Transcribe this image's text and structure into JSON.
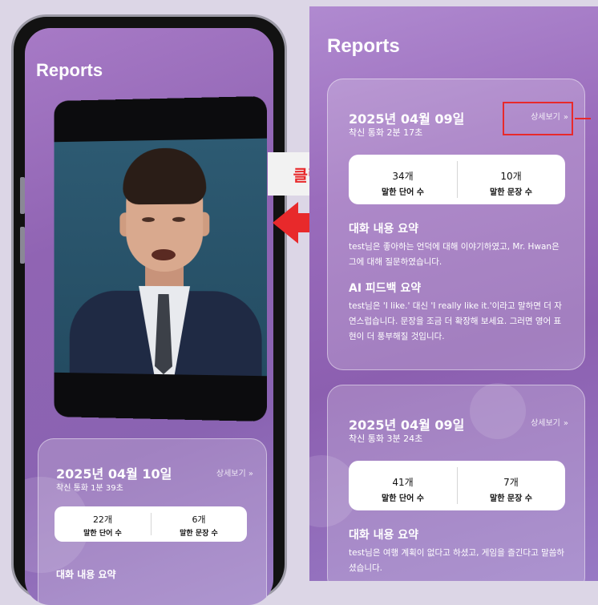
{
  "left_phone": {
    "title": "Reports",
    "mini_card": {
      "date": "2025년 04월 10일",
      "sub": "착신 통화 1분 39초",
      "detail": "상세보기 »",
      "stats": [
        {
          "value": "22개",
          "label": "말한 단어 수"
        },
        {
          "value": "6개",
          "label": "말한 문장 수"
        }
      ],
      "summary_head": "대화 내용 요약"
    }
  },
  "annotation": {
    "click_label": "클릭",
    "accent_color": "#e8292b"
  },
  "right_screen": {
    "title": "Reports",
    "cards": [
      {
        "date": "2025년 04월 09일",
        "sub": "착신 통화 2분 17초",
        "detail": "상세보기",
        "detail_chevron": "»",
        "stats": [
          {
            "value": "34개",
            "label": "말한 단어 수"
          },
          {
            "value": "10개",
            "label": "말한 문장 수"
          }
        ],
        "summary_head": "대화 내용 요약",
        "summary_body": "test님은 좋아하는 언덕에 대해 이야기하였고, Mr. Hwan은 그에 대해 질문하였습니다.",
        "feedback_head": "AI 피드백 요약",
        "feedback_body": "test님은 'I like.' 대신 'I really like it.'이라고 말하면 더 자연스럽습니다. 문장을 조금 더 확장해 보세요. 그러면 영어 표현이 더 풍부해질 것입니다."
      },
      {
        "date": "2025년 04월 09일",
        "sub": "착신 통화 3분 24초",
        "detail": "상세보기",
        "detail_chevron": "»",
        "stats": [
          {
            "value": "41개",
            "label": "말한 단어 수"
          },
          {
            "value": "7개",
            "label": "말한 문장 수"
          }
        ],
        "summary_head": "대화 내용 요약",
        "summary_body": "test님은 여행 계획이 없다고 하셨고, 게임을 즐긴다고 말씀하셨습니다."
      }
    ]
  }
}
